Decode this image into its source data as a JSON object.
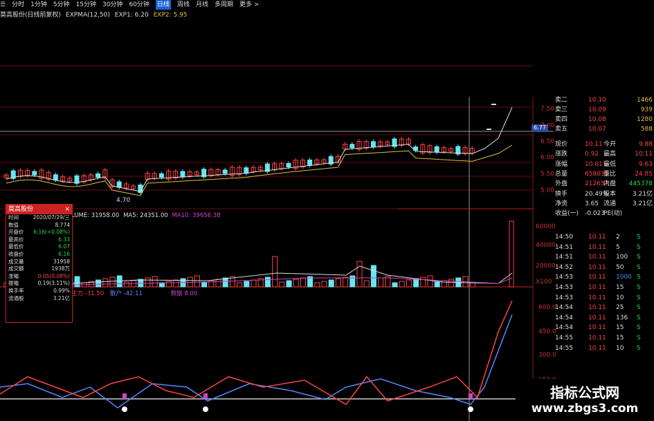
{
  "toolbar": {
    "items": [
      "分时",
      "1分钟",
      "5分钟",
      "15分钟",
      "30分钟",
      "60分钟",
      "日线",
      "周线",
      "月线",
      "多周期",
      "更多 >"
    ],
    "active_index": 6,
    "first_glyph": "☰"
  },
  "main_title": {
    "stock": "莫高股份(日线前复权)",
    "indicator": "EXPMA(12,50)",
    "exp1": "EXP1: 6.20",
    "exp2": "EXP2: 5.95"
  },
  "price_axis": [
    "7.50",
    "7.00",
    "6.50",
    "6.00",
    "5.50",
    "5.00"
  ],
  "price_tag": "6.77",
  "low_marker": "4.70",
  "volume_title": {
    "vol": "LUME: 31958.00",
    "ma5": "MA5: 24351.00",
    "ma10": "MA10: 39656.38"
  },
  "volume_axis": [
    "60000",
    "40000",
    "20000"
  ],
  "volume_axis_unit": "X100",
  "indicator_line": {
    "a": "主力 -31.50",
    "b": "散户 -42.11",
    "c": "数据 8.00"
  },
  "indicator_axis": [
    "600.0",
    "450.0",
    "300.0",
    "150.0"
  ],
  "info_window": {
    "title": "莫高股份",
    "close": "×",
    "rows": [
      {
        "k": "时间",
        "v": "2020/07/29/三"
      },
      {
        "k": "数值",
        "v": "8.774"
      },
      {
        "k": "开盘价",
        "v": "6.16(+0.08%)"
      },
      {
        "k": "最高价",
        "v": "6.33"
      },
      {
        "k": "最低价",
        "v": "6.07"
      },
      {
        "k": "收盘价",
        "v": "6.16"
      },
      {
        "k": "成交量",
        "v": "31958"
      },
      {
        "k": "成交额",
        "v": "1938万"
      },
      {
        "k": "涨幅",
        "v": "0.05(0.08%)"
      },
      {
        "k": "振幅",
        "v": "0.19(3.11%)"
      },
      {
        "k": "换手率",
        "v": "0.99%"
      },
      {
        "k": "流通股",
        "v": "3.21亿"
      }
    ]
  },
  "order_book": [
    {
      "label": "卖二",
      "price": "10.10",
      "vol": "1466"
    },
    {
      "label": "卖三",
      "price": "10.09",
      "vol": "939"
    },
    {
      "label": "卖四",
      "price": "10.08",
      "vol": "1280"
    },
    {
      "label": "卖五",
      "price": "10.07",
      "vol": "588"
    }
  ],
  "quote_rows": [
    {
      "l1": "现价",
      "v1": "10.11",
      "l2": "今开",
      "v2": "9.88"
    },
    {
      "l1": "涨跌",
      "v1": "0.92",
      "l2": "最高",
      "v2": "10.11"
    },
    {
      "l1": "涨幅",
      "v1": "10.01%",
      "l2": "最低",
      "v2": "9.63"
    },
    {
      "l1": "总量",
      "v1": "658035",
      "l2": "量比",
      "v2": "24.85"
    },
    {
      "l1": "外盘",
      "v1": "212657",
      "l2": "内盘",
      "v2": "445378"
    },
    {
      "l1": "换手",
      "v1": "20.49%",
      "l2": "股本",
      "v2": "3.21亿"
    },
    {
      "l1": "净资",
      "v1": "3.65",
      "l2": "流通",
      "v2": "3.21亿"
    },
    {
      "l1": "收益(一)",
      "v1": "-0.023",
      "l2": "PE(动)",
      "v2": ""
    }
  ],
  "ticks": [
    {
      "t": "14:50",
      "p": "10.11",
      "v": "2",
      "s": "S"
    },
    {
      "t": "14:51",
      "p": "10.11",
      "v": "5",
      "s": "S"
    },
    {
      "t": "14:51",
      "p": "10.11",
      "v": "100",
      "s": "S"
    },
    {
      "t": "14:52",
      "p": "10.11",
      "v": "50",
      "s": "S"
    },
    {
      "t": "14:53",
      "p": "10.11",
      "v": "1000",
      "s": "S"
    },
    {
      "t": "14:53",
      "p": "10.11",
      "v": "15",
      "s": "S"
    },
    {
      "t": "14:53",
      "p": "10.11",
      "v": "10",
      "s": "S"
    },
    {
      "t": "14:54",
      "p": "10.11",
      "v": "25",
      "s": "S"
    },
    {
      "t": "14:54",
      "p": "10.11",
      "v": "136",
      "s": "S"
    },
    {
      "t": "14:54",
      "p": "10.11",
      "v": "15",
      "s": "S"
    },
    {
      "t": "14:55",
      "p": "10.11",
      "v": "15",
      "s": "S"
    },
    {
      "t": "14:55",
      "p": "10.11",
      "v": "10",
      "s": "S"
    }
  ],
  "watermark": {
    "line1": "指标公式网",
    "line2": "www.zbgs3.com"
  },
  "colors": {
    "up": "#ff4444",
    "down": "#22dd44",
    "cyan": "#66e6f0",
    "grid": "#7a1010",
    "white": "#dddddd"
  }
}
